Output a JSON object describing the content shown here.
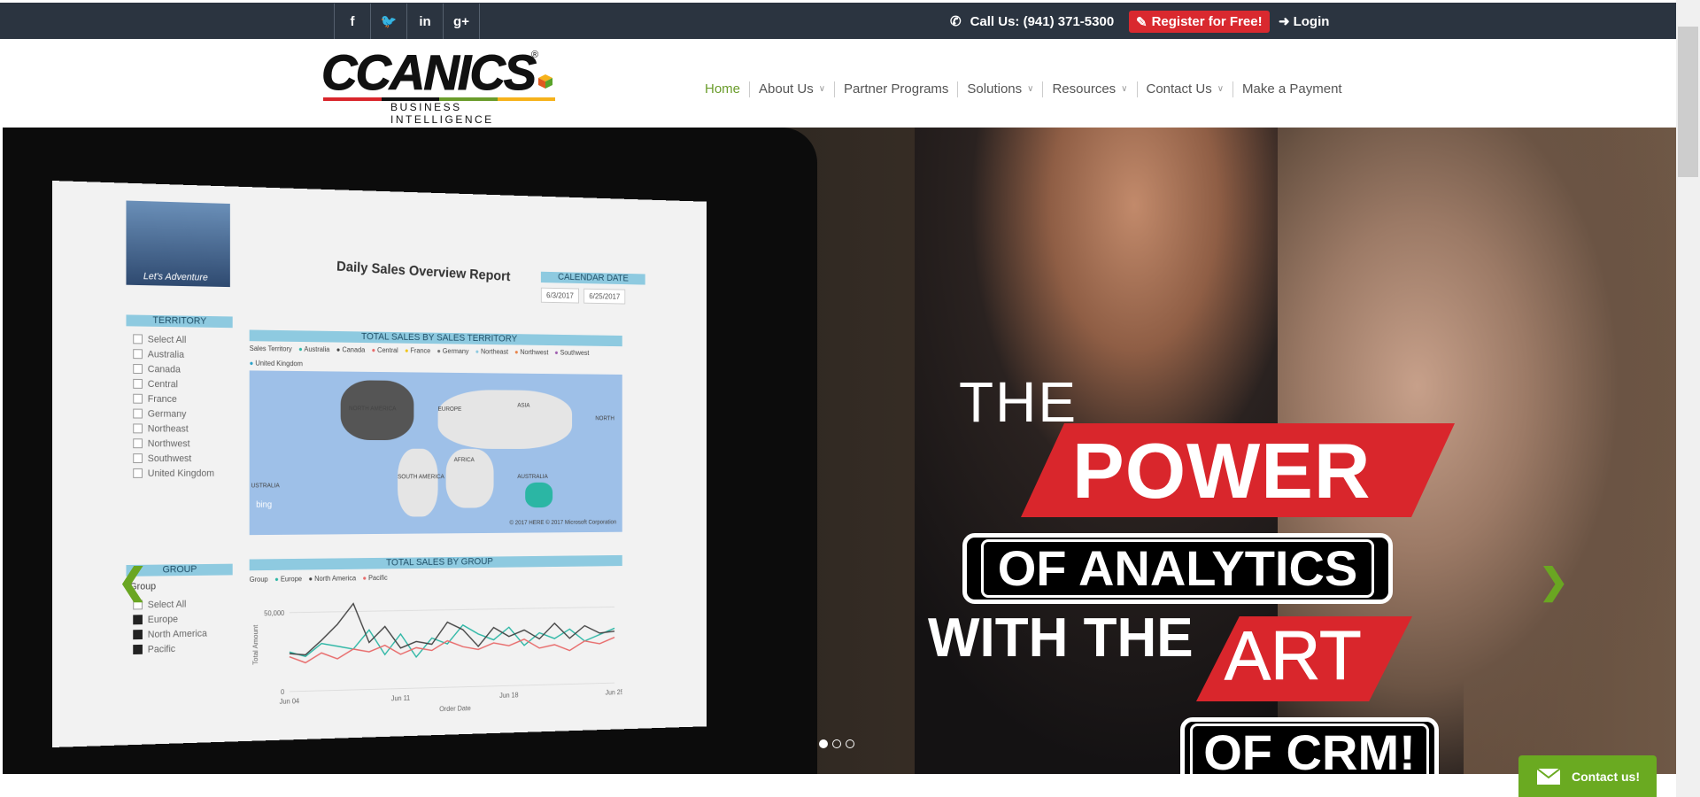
{
  "topbar": {
    "social": [
      {
        "icon": "facebook-icon",
        "glyph": "f"
      },
      {
        "icon": "twitter-icon",
        "glyph": "🐦"
      },
      {
        "icon": "linkedin-icon",
        "glyph": "in"
      },
      {
        "icon": "google-plus-icon",
        "glyph": "g+"
      }
    ],
    "call_label": "Call Us: (941) 371-5300",
    "register_label": "Register for Free!",
    "login_label": "Login"
  },
  "header": {
    "logo_word": "CCANICS",
    "logo_reg": "®",
    "logo_subtitle": "BUSINESS INTELLIGENCE",
    "nav": [
      {
        "label": "Home",
        "active": true,
        "dropdown": false
      },
      {
        "label": "About Us",
        "active": false,
        "dropdown": true
      },
      {
        "label": "Partner Programs",
        "active": false,
        "dropdown": false
      },
      {
        "label": "Solutions",
        "active": false,
        "dropdown": true
      },
      {
        "label": "Resources",
        "active": false,
        "dropdown": true
      },
      {
        "label": "Contact Us",
        "active": false,
        "dropdown": true
      },
      {
        "label": "Make a Payment",
        "active": false,
        "dropdown": false
      }
    ]
  },
  "dashboard": {
    "thumb_caption": "Let's Adventure",
    "title": "Daily Sales Overview Report",
    "calendar_label": "CALENDAR DATE",
    "date_from": "6/3/2017",
    "date_to": "6/25/2017",
    "territory_label": "TERRITORY",
    "territories": [
      "Select All",
      "Australia",
      "Canada",
      "Central",
      "France",
      "Germany",
      "Northeast",
      "Northwest",
      "Southwest",
      "United Kingdom"
    ],
    "map_title": "TOTAL SALES BY SALES TERRITORY",
    "map_legend_label": "Sales Territory",
    "map_legend": [
      "Australia",
      "Canada",
      "Central",
      "France",
      "Germany",
      "Northeast",
      "Northwest",
      "Southwest",
      "United Kingdom"
    ],
    "map_labels": [
      "NORTH AMERICA",
      "EUROPE",
      "ASIA",
      "AFRICA",
      "SOUTH AMERICA",
      "AUSTRALIA",
      "USTRALIA",
      "NORTH"
    ],
    "map_credit": "© 2017 HERE  © 2017 Microsoft Corporation",
    "bing": "bing",
    "group_label": "GROUP",
    "group_select": "Group",
    "groups": [
      {
        "label": "Select All",
        "checked": false
      },
      {
        "label": "Europe",
        "checked": true
      },
      {
        "label": "North America",
        "checked": true
      },
      {
        "label": "Pacific",
        "checked": true
      }
    ],
    "linechart_title": "TOTAL SALES BY GROUP",
    "linechart_legend_label": "Group",
    "y_axis_label": "Total Amount",
    "x_axis_label": "Order Date",
    "y_ticks": [
      "50,000",
      "0"
    ],
    "x_ticks": [
      "Jun 04",
      "Jun 11",
      "Jun 18",
      "Jun 25"
    ],
    "series_colors": {
      "Europe": "#2bb6a4",
      "North America": "#444444",
      "Pacific": "#e86b6b"
    }
  },
  "chart_data": {
    "type": "line",
    "title": "TOTAL SALES BY GROUP",
    "xlabel": "Order Date",
    "ylabel": "Total Amount",
    "ylim": [
      0,
      60000
    ],
    "x": [
      "Jun 04",
      "Jun 05",
      "Jun 06",
      "Jun 07",
      "Jun 08",
      "Jun 09",
      "Jun 10",
      "Jun 11",
      "Jun 12",
      "Jun 13",
      "Jun 14",
      "Jun 15",
      "Jun 16",
      "Jun 17",
      "Jun 18",
      "Jun 19",
      "Jun 20",
      "Jun 21",
      "Jun 22",
      "Jun 23",
      "Jun 24",
      "Jun 25"
    ],
    "x_tick_labels": [
      "Jun 04",
      "Jun 11",
      "Jun 18",
      "Jun 25"
    ],
    "series": [
      {
        "name": "Europe",
        "values": [
          25000,
          22000,
          30000,
          28000,
          26000,
          38000,
          22000,
          35000,
          20000,
          32000,
          28000,
          40000,
          34000,
          30000,
          38000,
          26000,
          34000,
          30000,
          36000,
          28000,
          32000,
          36000
        ]
      },
      {
        "name": "North America",
        "values": [
          24000,
          23000,
          32000,
          42000,
          55000,
          30000,
          40000,
          26000,
          30000,
          28000,
          42000,
          37000,
          26000,
          38000,
          32000,
          36000,
          30000,
          40000,
          30000,
          38000,
          33000,
          34000
        ]
      },
      {
        "name": "Pacific",
        "values": [
          22000,
          18000,
          24000,
          20000,
          26000,
          24000,
          28000,
          22000,
          26000,
          24000,
          30000,
          26000,
          24000,
          28000,
          26000,
          30000,
          24000,
          26000,
          22000,
          28000,
          26000,
          30000
        ]
      }
    ],
    "legend": "top-left",
    "grid": true
  },
  "hero": {
    "line_the": "THE",
    "line_power": "POWER",
    "line_analytics": "OF ANALYTICS",
    "line_with_the": "WITH THE",
    "line_art": "ART",
    "line_crm": "OF CRM!",
    "slides": 3,
    "active_slide": 1
  },
  "contact_widget": {
    "label": "Contact us!"
  },
  "colors": {
    "topbar": "#2b3440",
    "accent_green": "#6a9c2b",
    "accent_red": "#d9262c"
  }
}
